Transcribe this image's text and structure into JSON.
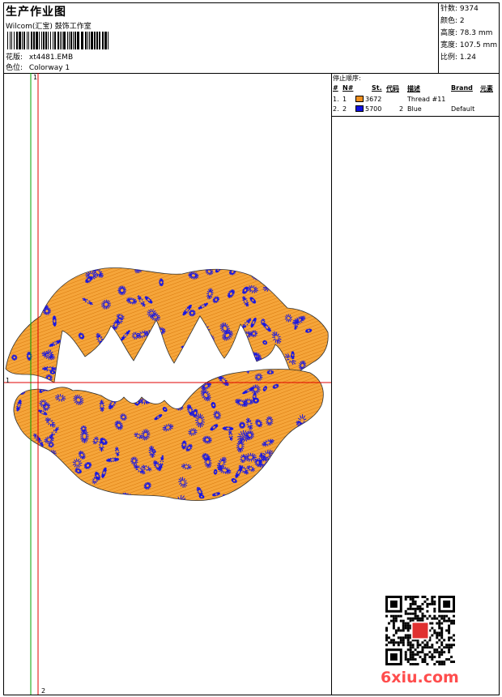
{
  "header": {
    "title": "生产作业图",
    "subtitle": "Wilcom(汇宝) 鼓饰工作室",
    "design_label": "花版:",
    "design_value": "xt4481.EMB",
    "colorway_label": "色位:",
    "colorway_value": "Colorway 1"
  },
  "stats": [
    {
      "label": "针数:",
      "value": "9374"
    },
    {
      "label": "颜色:",
      "value": "2"
    },
    {
      "label": "高度:",
      "value": "78.3 mm"
    },
    {
      "label": "宽度:",
      "value": "107.5 mm"
    },
    {
      "label": "比例:",
      "value": "1.24"
    }
  ],
  "stops": {
    "heading": "停止顺序:",
    "columns": [
      "#",
      "N#",
      "St.",
      "代码",
      "描述",
      "Brand",
      "元素"
    ],
    "rows": [
      {
        "index": "1.",
        "n": "1",
        "code": "3672",
        "st": "",
        "desc": "Thread #11",
        "brand": "",
        "color": "#f0901e"
      },
      {
        "index": "2.",
        "n": "2",
        "code": "5700",
        "st": "2",
        "desc": "Blue",
        "brand": "Default",
        "color": "#1010e0"
      }
    ]
  },
  "guides": {
    "vertical_label": "1",
    "horizontal_label": "1",
    "bottom_label": "2"
  },
  "colors": {
    "orange": "#f0901e",
    "blue": "#1414e6",
    "guide_red": "#e00000",
    "guide_green": "#00a000"
  },
  "watermark": "6xiu.com"
}
